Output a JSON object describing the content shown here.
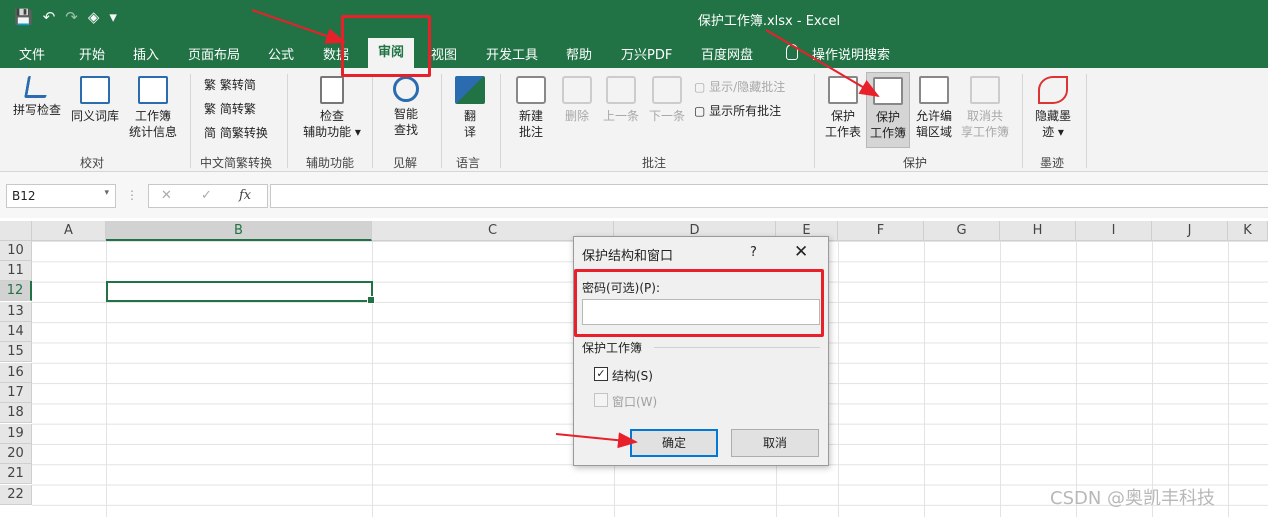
{
  "window": {
    "title": "保护工作簿.xlsx  -  Excel"
  },
  "quick_access": {
    "save": "💾",
    "undo": "↶",
    "redo": "↷",
    "fill": "◈",
    "more": "▾"
  },
  "tabs": [
    {
      "label": "文件"
    },
    {
      "label": "开始"
    },
    {
      "label": "插入"
    },
    {
      "label": "页面布局"
    },
    {
      "label": "公式"
    },
    {
      "label": "数据"
    },
    {
      "label": "审阅"
    },
    {
      "label": "视图"
    },
    {
      "label": "开发工具"
    },
    {
      "label": "帮助"
    },
    {
      "label": "万兴PDF"
    },
    {
      "label": "百度网盘"
    },
    {
      "label": "操作说明搜索"
    }
  ],
  "ribbon": {
    "proofing": {
      "spell": "拼写检查",
      "thesaurus": "同义词库",
      "stats1": "工作簿",
      "stats2": "统计信息",
      "group": "校对"
    },
    "chinese": {
      "t2s": "繁转简",
      "s2t": "简转繁",
      "convert": "简繁转换",
      "group": "中文简繁转换"
    },
    "accessibility": {
      "label1": "检查",
      "label2": "辅助功能",
      "group": "辅助功能"
    },
    "insights": {
      "label1": "智能",
      "label2": "查找",
      "group": "见解"
    },
    "language": {
      "label1": "翻",
      "label2": "译",
      "group": "语言"
    },
    "comments": {
      "new1": "新建",
      "new2": "批注",
      "delete": "删除",
      "prev": "上一条",
      "next": "下一条",
      "show_hide": "显示/隐藏批注",
      "show_all": "显示所有批注",
      "group": "批注"
    },
    "protect": {
      "sheet1": "保护",
      "sheet2": "工作表",
      "book1": "保护",
      "book2": "工作簿",
      "ranges1": "允许编",
      "ranges2": "辑区域",
      "share1": "取消共",
      "share2": "享工作簿",
      "group": "保护"
    },
    "ink": {
      "label1": "隐藏墨",
      "label2": "迹",
      "group": "墨迹"
    }
  },
  "formula_bar": {
    "name_box": "B12",
    "cancel": "✕",
    "enter": "✓",
    "fx": "fx"
  },
  "sheet": {
    "columns": [
      "A",
      "B",
      "C",
      "D",
      "E",
      "F",
      "G",
      "H",
      "I",
      "J",
      "K"
    ],
    "rows": [
      "10",
      "11",
      "12",
      "13",
      "14",
      "15",
      "16",
      "17",
      "18",
      "19",
      "20",
      "21",
      "22"
    ],
    "selected_cell": "B12"
  },
  "dialog": {
    "title": "保护结构和窗口",
    "help": "?",
    "close": "✕",
    "password_label": "密码(可选)(P):",
    "password_value": "",
    "group_label": "保护工作簿",
    "structure_label": "结构(S)",
    "structure_checked": "✓",
    "windows_label": "窗口(W)",
    "ok": "确定",
    "cancel": "取消"
  },
  "watermark": "CSDN @奥凯丰科技"
}
